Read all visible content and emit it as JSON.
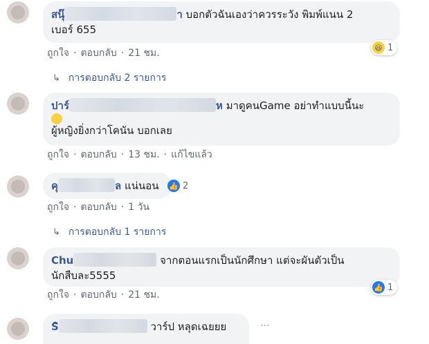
{
  "comments": [
    {
      "name_prefix": "สนุ๊",
      "name_suffix": "า",
      "text_line1": "บอกตัวฉันเองว่าควรระวัง พิมพ์แนน 2",
      "text_line2": "เบอร์ 655",
      "like_label": "ถูกใจ",
      "reply_label": "ตอบกลับ",
      "time": "21 ชม.",
      "reaction_icon": "haha-icon",
      "reaction_count": "1",
      "replies_label": "การตอบกลับ 2 รายการ"
    },
    {
      "name_prefix": "ปาร์",
      "name_suffix": "ห",
      "text_line1": "มาดูคนGame อย่าทำแบบนี้นะ",
      "text_line2": "ผู้หญิงยิ่งกว่าโคนัน บอกเลย",
      "like_label": "ถูกใจ",
      "reply_label": "ตอบกลับ",
      "time": "13 ชม.",
      "edited_label": "แก้ไขแล้ว"
    },
    {
      "name_prefix": "คุ",
      "name_suffix": "ล",
      "text_line1": "แน่นอน",
      "like_label": "ถูกใจ",
      "reply_label": "ตอบกลับ",
      "time": "1 วัน",
      "reaction_icon": "like-icon",
      "reaction_count": "2",
      "replies_label": "การตอบกลับ 1 รายการ"
    },
    {
      "name_prefix": "Chu",
      "text_line1": "จากตอนแรกเป็นนักศึกษา แต่จะผันตัวเป็น",
      "text_line2": "นักสืบละ5555",
      "like_label": "ถูกใจ",
      "reply_label": "ตอบกลับ",
      "time": "21 ชม.",
      "reaction_icon": "like-icon",
      "reaction_count": "1"
    },
    {
      "name_prefix": "Sิ",
      "text_line1": "วาร์ป หลุดเฉยยย",
      "more_icon": "more-options-icon",
      "more_glyph": "···"
    }
  ],
  "separator": "·",
  "reply_arrow": "↳"
}
